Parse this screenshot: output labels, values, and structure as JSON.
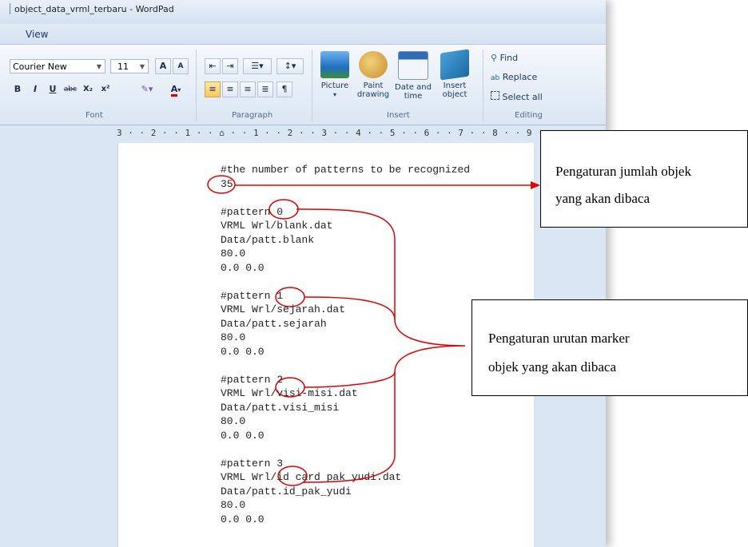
{
  "window": {
    "title": "object_data_vrml_terbaru - WordPad"
  },
  "menu": {
    "view": "View"
  },
  "ribbon": {
    "font": {
      "family": "Courier New",
      "size": "11",
      "group_label": "Font",
      "bold": "B",
      "italic": "I",
      "underline": "U",
      "strike": "abc",
      "subscript": "X₂",
      "superscript": "x²",
      "grow": "A",
      "shrink": "A",
      "font_color": "A"
    },
    "paragraph": {
      "group_label": "Paragraph"
    },
    "insert": {
      "group_label": "Insert",
      "picture": "Picture",
      "paint": "Paint drawing",
      "datetime": "Date and time",
      "object": "Insert object"
    },
    "editing": {
      "group_label": "Editing",
      "find": "Find",
      "replace": "Replace",
      "select_all": "Select all"
    }
  },
  "ruler": {
    "text": "3 · · 2 · · 1 · · ⌂ · · 1 · · 2 · · 3 · · 4 · · 5 · · 6 · · 7 · · 8 · · 9 · ·"
  },
  "document": {
    "lines": [
      "#the number of patterns to be recognized",
      "35",
      "",
      "#pattern 0",
      "VRML Wrl/blank.dat",
      "Data/patt.blank",
      "80.0",
      "0.0 0.0",
      "",
      "#pattern 1",
      "VRML Wrl/sejarah.dat",
      "Data/patt.sejarah",
      "80.0",
      "0.0 0.0",
      "",
      "#pattern 2",
      "VRML Wrl/visi-misi.dat",
      "Data/patt.visi_misi",
      "80.0",
      "0.0 0.0",
      "",
      "#pattern 3",
      "VRML Wrl/id card pak yudi.dat",
      "Data/patt.id_pak_yudi",
      "80.0",
      "0.0 0.0"
    ]
  },
  "annotations": {
    "callout_1": [
      "Pengaturan jumlah objek",
      "yang akan dibaca"
    ],
    "callout_2": [
      "Pengaturan urutan marker",
      "objek yang akan dibaca"
    ],
    "color": "#e00000"
  }
}
